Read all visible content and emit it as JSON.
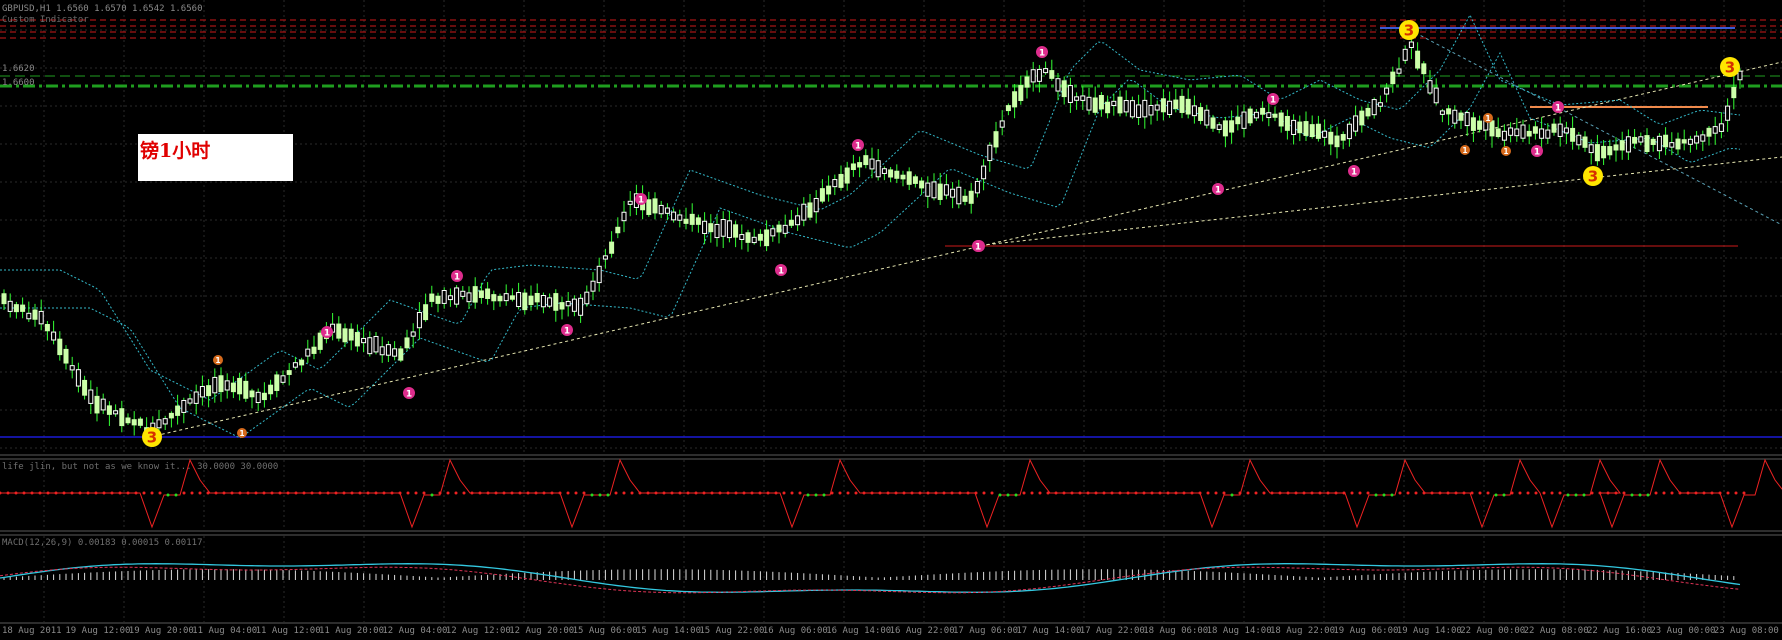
{
  "main_window": {
    "symbol_header": "GBPUSD,H1  1.6560 1.6570 1.6542 1.6560",
    "indicator_caption": "Custom Indicator",
    "level_label_1": "1.6620",
    "level_label_2": "1.6600",
    "annotation_text": "镑1小时"
  },
  "indicator_window_1": {
    "caption": "life jlin, but not as we know it...  30.0000 30.0000"
  },
  "indicator_window_2": {
    "caption": "MACD(12,26,9) 0.00183 0.00015 0.00117"
  },
  "time_axis": {
    "labels": [
      "18 Aug 2011",
      "19 Aug 12:00",
      "19 Aug 20:00",
      "11 Aug 04:00",
      "11 Aug 12:00",
      "11 Aug 20:00",
      "12 Aug 04:00",
      "12 Aug 12:00",
      "12 Aug 20:00",
      "15 Aug 06:00",
      "15 Aug 14:00",
      "15 Aug 22:00",
      "16 Aug 06:00",
      "16 Aug 14:00",
      "16 Aug 22:00",
      "17 Aug 06:00",
      "17 Aug 14:00",
      "17 Aug 22:00",
      "18 Aug 06:00",
      "18 Aug 14:00",
      "18 Aug 22:00",
      "19 Aug 06:00",
      "19 Aug 14:00",
      "22 Aug 00:00",
      "22 Aug 08:00",
      "22 Aug 16:00",
      "23 Aug 00:00",
      "23 Aug 08:00"
    ]
  },
  "colors": {
    "background": "#000000",
    "grid": "#2a2a2a",
    "bull_candle": "#ccffaa",
    "bear_candle": "#ffffff",
    "wick": "#33ff33",
    "ma_line": "#33b8c8",
    "trend_line": "#e6e6b0",
    "support_line": "#1b1bd6",
    "red_line": "#cc1a1a",
    "green_dash": "#1f9e1f",
    "pink_marker": "#dd2c8c",
    "orange_marker": "#d66a1c",
    "yellow_marker": "#ffe600",
    "osc_green": "#22dd22",
    "osc_red": "#ee2222",
    "macd_line": "#33c8e0",
    "macd_signal": "#dd3355"
  },
  "markers": {
    "wave_number": "3",
    "small_label": "1"
  }
}
